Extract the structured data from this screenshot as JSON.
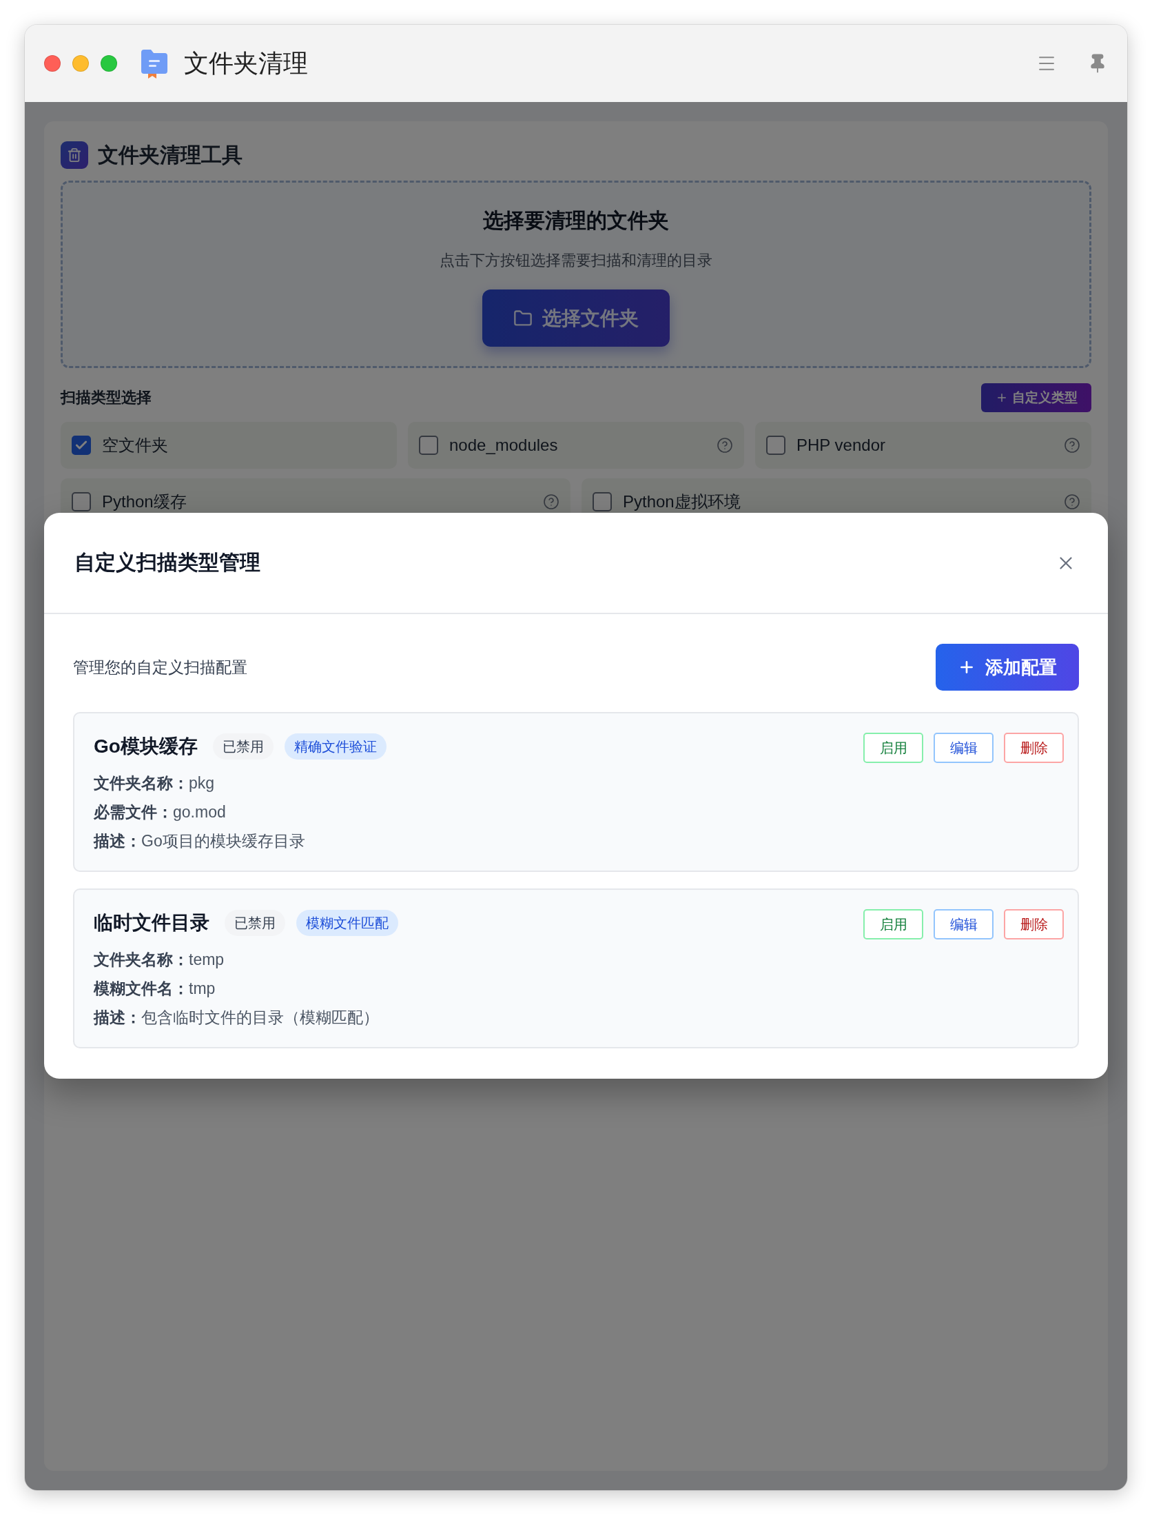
{
  "window": {
    "title": "文件夹清理"
  },
  "app": {
    "title": "文件夹清理工具",
    "picker": {
      "title": "选择要清理的文件夹",
      "subtitle": "点击下方按钮选择需要扫描和清理的目录",
      "button": "选择文件夹"
    },
    "scan_types": {
      "label": "扫描类型选择",
      "add_button": "自定义类型",
      "rows": [
        [
          {
            "label": "空文件夹",
            "checked": true,
            "help": false
          },
          {
            "label": "node_modules",
            "checked": false,
            "help": true
          },
          {
            "label": "PHP vendor",
            "checked": false,
            "help": true
          }
        ],
        [
          {
            "label": "Python缓存",
            "checked": false,
            "help": true
          },
          {
            "label": "Python虚拟环境",
            "checked": false,
            "help": true
          }
        ]
      ]
    }
  },
  "modal": {
    "title": "自定义扫描类型管理",
    "subtitle": "管理您的自定义扫描配置",
    "add_button": "添加配置",
    "configs": [
      {
        "name": "Go模块缓存",
        "enabled": false,
        "status": "已禁用",
        "match": "精确文件验证",
        "fields": [
          {
            "label": "文件夹名称：",
            "value": "pkg"
          },
          {
            "label": "必需文件：",
            "value": "go.mod"
          },
          {
            "label": "描述：",
            "value": "Go项目的模块缓存目录"
          }
        ],
        "actions": [
          {
            "kind": "enable",
            "label": "启用"
          },
          {
            "kind": "edit",
            "label": "编辑"
          },
          {
            "kind": "delete",
            "label": "删除"
          }
        ]
      },
      {
        "name": "临时文件目录",
        "enabled": false,
        "status": "已禁用",
        "match": "模糊文件匹配",
        "fields": [
          {
            "label": "文件夹名称：",
            "value": "temp"
          },
          {
            "label": "模糊文件名：",
            "value": "tmp"
          },
          {
            "label": "描述：",
            "value": "包含临时文件的目录（模糊匹配）"
          }
        ],
        "actions": [
          {
            "kind": "enable",
            "label": "启用"
          },
          {
            "kind": "edit",
            "label": "编辑"
          },
          {
            "kind": "delete",
            "label": "删除"
          }
        ]
      }
    ]
  }
}
